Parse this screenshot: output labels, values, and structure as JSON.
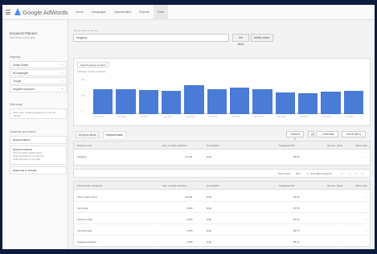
{
  "app": {
    "title": "Google AdWords"
  },
  "nav": {
    "tabs": [
      "Home",
      "Campaigns",
      "Opportunities",
      "Reports",
      "Tools"
    ]
  },
  "sidebar": {
    "title": "Keyword Planner",
    "subtitle": "Add ideas to your plan",
    "targeting_label": "Targeting",
    "targeting": [
      "United States",
      "All languages",
      "Google",
      "Negative keywords"
    ],
    "date_label": "Date range",
    "date_text": "Show avg. monthly searches for: last 12 months",
    "customize_label": "Customize your search",
    "keyword_filters_title": "Keyword filters",
    "keyword_options_title": "Keyword options",
    "keyword_options_lines": [
      "Show broadly related ideas",
      "Hide keywords in my account",
      "Hide keywords in my plan"
    ],
    "include_title": "Keywords to include"
  },
  "search": {
    "label": "Your product or service",
    "value": "blogging",
    "get_ideas": "Get ideas",
    "modify_search": "Modify search"
  },
  "chart": {
    "chip": "Search volume trends",
    "title": "Average monthly searches",
    "color": "#4a7bd6"
  },
  "chart_data": {
    "type": "bar",
    "categories": [
      "May 2013",
      "Jun 2013",
      "Jul 2013",
      "Aug 2013",
      "Sep 2013",
      "Oct 2013",
      "Nov 2013",
      "Dec 2013",
      "Jan 2014",
      "Feb 2014",
      "Mar 2014",
      "Apr 2014"
    ],
    "values": [
      14000,
      14000,
      13500,
      13000,
      16500,
      14300,
      14800,
      14200,
      12300,
      12000,
      12800,
      13300
    ],
    "ylim": [
      0,
      20000
    ],
    "yticks": [
      "20K",
      "10K",
      "0"
    ]
  },
  "tabs": {
    "ad_group": "Ad group ideas",
    "keyword": "Keyword ideas"
  },
  "toolbar": {
    "columns": "Columns",
    "download": "Download",
    "add_all": "Add all (801)"
  },
  "search_terms": {
    "headers": [
      "Search terms",
      "Avg. monthly searches",
      "Competition",
      "Suggested bid",
      "Ad impr. share",
      "Add to plan"
    ],
    "rows": [
      {
        "term": "blogging",
        "searches": "12,100",
        "competition": "High",
        "bid": "$5.86"
      }
    ]
  },
  "pager": {
    "show_rows": "Show rows:",
    "rows": "30",
    "range": "1 - 30 of 801 keywords"
  },
  "keyword_ideas": {
    "headers": [
      "Keyword (by relevance)",
      "Avg. monthly searches",
      "Competition",
      "Suggested bid",
      "Ad impr. share",
      "Add to plan"
    ],
    "rows": [
      {
        "term": "how to start a blog",
        "searches": "49,500",
        "competition": "High",
        "bid": "$3.26"
      },
      {
        "term": "free blogs",
        "searches": "2,900",
        "competition": "High",
        "bid": "$7.55"
      },
      {
        "term": "starting a blog",
        "searches": "2,900",
        "competition": "High",
        "bid": "$7.52"
      },
      {
        "term": "free blog sites",
        "searches": "2,900",
        "competition": "High",
        "bid": "$5.73"
      },
      {
        "term": "blogging websites",
        "searches": "1,900",
        "competition": "High",
        "bid": "$5.11"
      }
    ]
  }
}
